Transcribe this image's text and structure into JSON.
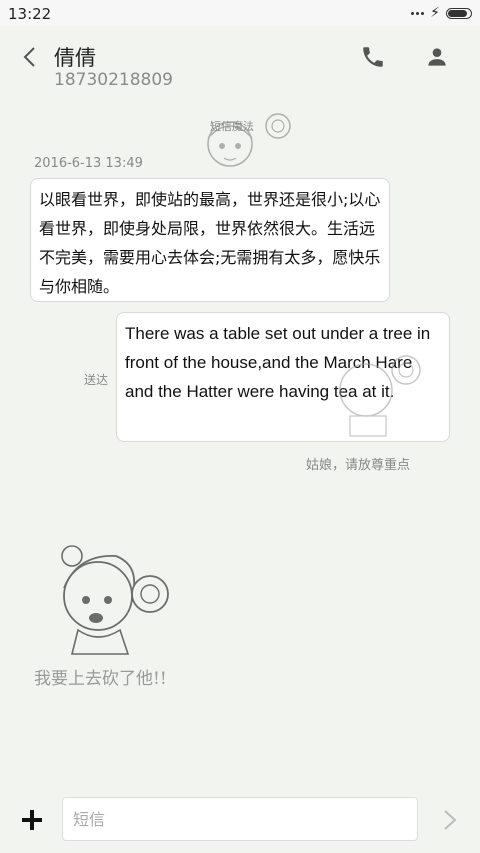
{
  "status_bar": {
    "time": "13:22"
  },
  "header": {
    "contact_name": "倩倩",
    "contact_number": "18730218809"
  },
  "conversation": {
    "top_sticker_text": "短信魔法",
    "timestamp": "2016-6-13 13:49",
    "received_message": "以眼看世界，即使站的最高，世界还是很小;以心看世界，即使身处局限，世界依然很大。生活远不完美，需要用心去体会;无需拥有太多，愿快乐与你相随。",
    "sent_status": "送达",
    "sent_message": "There was a table set out under a tree in front of the house,and the March Hare and the Hatter were having tea at it.",
    "sticker_caption": "姑娘，请放尊重点",
    "big_sticker_caption": "我要上去砍了他!!"
  },
  "composer": {
    "input_value": "",
    "input_placeholder": "短信"
  }
}
